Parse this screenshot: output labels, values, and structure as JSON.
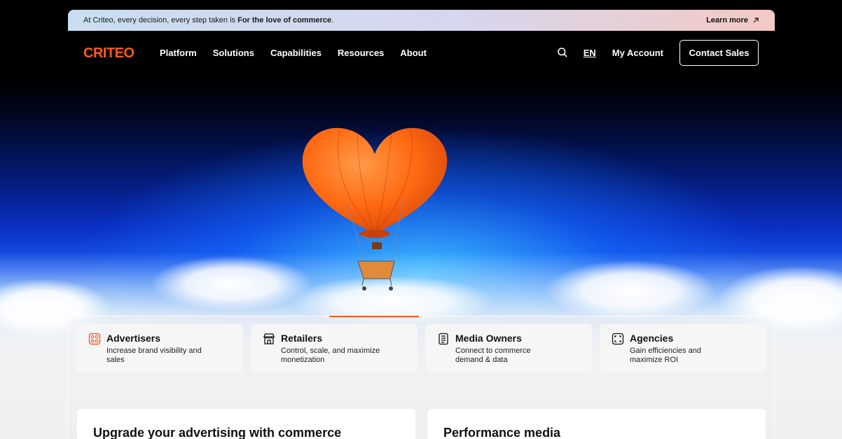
{
  "announcement": {
    "message": "At Criteo, every decision, every step taken is ",
    "message_bold": "For the love of commerce",
    "message_end": ".",
    "link_label": "Learn more"
  },
  "nav": {
    "brand": "CRITEO",
    "items": [
      {
        "label": "Platform"
      },
      {
        "label": "Solutions"
      },
      {
        "label": "Capabilities"
      },
      {
        "label": "Resources"
      },
      {
        "label": "About"
      }
    ],
    "language": "EN",
    "account_label": "My Account",
    "contact_label": "Contact Sales"
  },
  "segments": [
    {
      "icon": "grid-icon",
      "title": "Advertisers",
      "desc": "Increase brand visibility and sales"
    },
    {
      "icon": "storefront-icon",
      "title": "Retailers",
      "desc": "Control, scale, and maximize monetization"
    },
    {
      "icon": "document-icon",
      "title": "Media Owners",
      "desc": "Connect to commerce demand & data"
    },
    {
      "icon": "target-frame-icon",
      "title": "Agencies",
      "desc": "Gain efficiencies and maximize ROI"
    }
  ],
  "sections": [
    {
      "heading": "Upgrade your advertising with commerce"
    },
    {
      "heading": "Performance media"
    }
  ],
  "colors": {
    "brand": "#ff5a1f",
    "text_dark": "#111111",
    "nav_text": "#ffffff"
  }
}
